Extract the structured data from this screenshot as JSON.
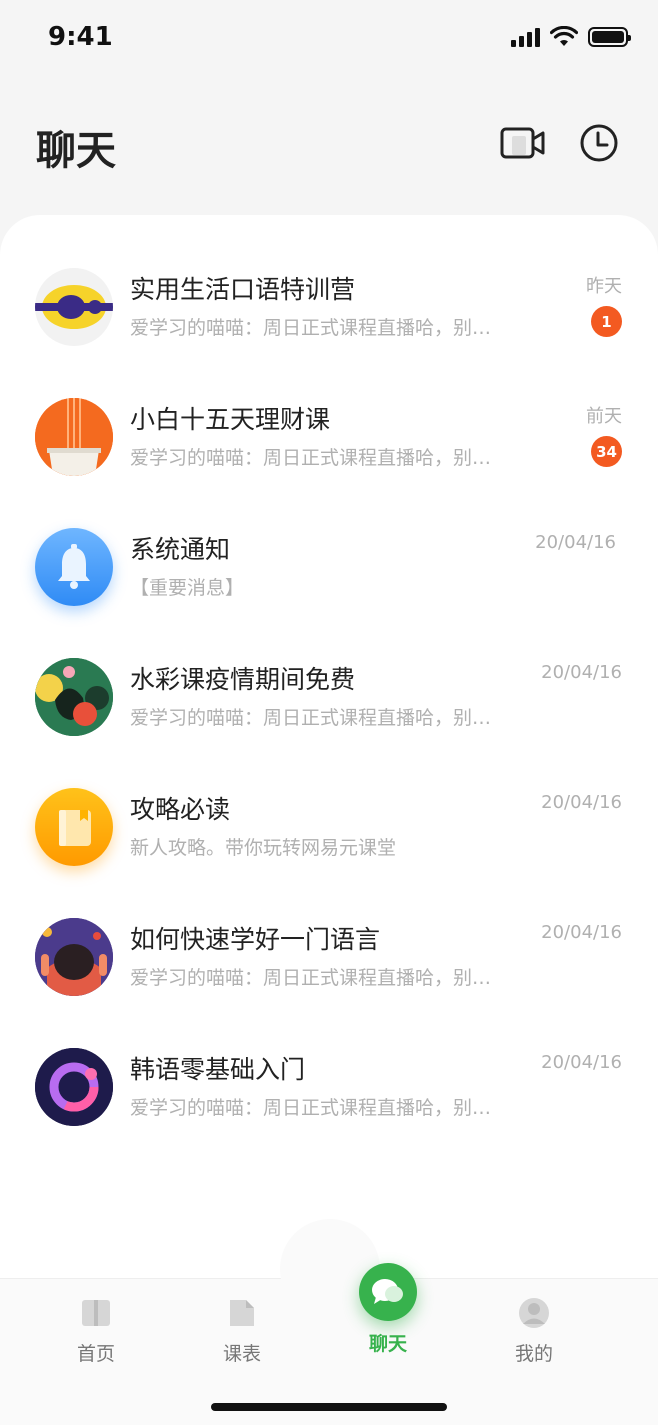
{
  "status_bar": {
    "time": "9:41"
  },
  "header": {
    "title": "聊天"
  },
  "chats": [
    {
      "name": "实用生活口语特训营",
      "preview": "爱学习的喵喵：周日正式课程直播哈，别…",
      "time": "昨天",
      "badge": "1"
    },
    {
      "name": "小白十五天理财课",
      "preview": "爱学习的喵喵：周日正式课程直播哈，别…",
      "time": "前天",
      "badge": "34"
    },
    {
      "name": "系统通知",
      "preview": "【重要消息】",
      "time": "20/04/16"
    },
    {
      "name": "水彩课疫情期间免费",
      "preview": "爱学习的喵喵：周日正式课程直播哈，别…",
      "time": "20/04/16"
    },
    {
      "name": "攻略必读",
      "preview": "新人攻略。带你玩转网易元课堂",
      "time": "20/04/16"
    },
    {
      "name": "如何快速学好一门语言",
      "preview": "爱学习的喵喵：周日正式课程直播哈，别…",
      "time": "20/04/16"
    },
    {
      "name": "韩语零基础入门",
      "preview": "爱学习的喵喵：周日正式课程直播哈，别…",
      "time": "20/04/16"
    }
  ],
  "tabs": [
    {
      "label": "首页",
      "icon": "book-icon"
    },
    {
      "label": "课表",
      "icon": "document-icon"
    },
    {
      "label": "聊天",
      "icon": "chat-bubbles-icon",
      "active": true
    },
    {
      "label": "我的",
      "icon": "profile-icon"
    }
  ],
  "colors": {
    "accent": "#37b24d",
    "badge": "#f35a21"
  }
}
